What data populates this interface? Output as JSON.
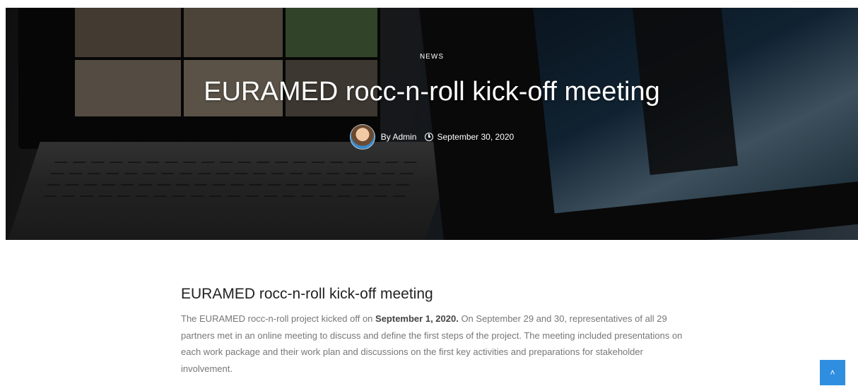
{
  "hero": {
    "category": "NEWS",
    "title": "EURAMED rocc-n-roll kick-off meeting",
    "author": "By Admin",
    "date": "September 30, 2020",
    "overlay_color": "#000000"
  },
  "post": {
    "title": "EURAMED rocc-n-roll kick-off meeting",
    "body_intro": "The EURAMED rocc-n-roll project kicked off on ",
    "body_bold": "September 1, 2020.",
    "body_rest": " On September 29 and 30, representatives of all 29 partners met in an online meeting to discuss and define the first steps of the project. The meeting included presentations on each work package and their work plan and discussions on the first key activities and preparations for stakeholder involvement."
  },
  "back_to_top": {
    "icon": "chevron-up-icon",
    "glyph": "˄",
    "color": "#2f8ee0"
  }
}
